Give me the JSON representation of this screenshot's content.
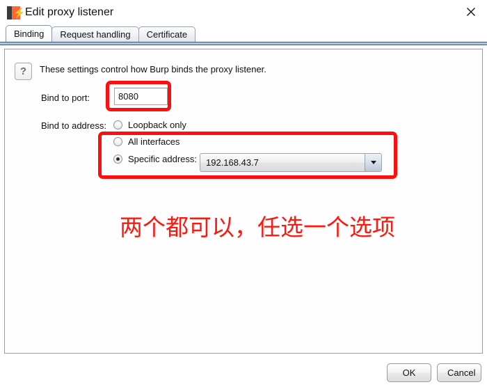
{
  "window": {
    "title": "Edit proxy listener",
    "app_icon": "burp-suite-icon",
    "close_icon": "close-icon"
  },
  "tabs": [
    {
      "label": "Binding",
      "active": true
    },
    {
      "label": "Request handling",
      "active": false
    },
    {
      "label": "Certificate",
      "active": false
    }
  ],
  "panel": {
    "help_icon": "question-mark-icon",
    "help_glyph": "?",
    "intro_text": "These settings control how Burp binds the proxy listener.",
    "bind_port": {
      "label": "Bind to port:",
      "value": "8080"
    },
    "bind_address": {
      "label": "Bind to address:",
      "options": [
        {
          "label": "Loopback only",
          "selected": false
        },
        {
          "label": "All interfaces",
          "selected": false
        },
        {
          "label": "Specific address:",
          "selected": true
        }
      ],
      "specific_address_value": "192.168.43.7",
      "dropdown_icon": "chevron-down-icon"
    }
  },
  "annotations": {
    "color": "#fb1a0f",
    "note_text": "两个都可以，任选一个选项",
    "highlighted_regions": [
      "bind-to-port-field",
      "address-radio-group"
    ]
  },
  "footer": {
    "ok_label": "OK",
    "cancel_label": "Cancel"
  }
}
